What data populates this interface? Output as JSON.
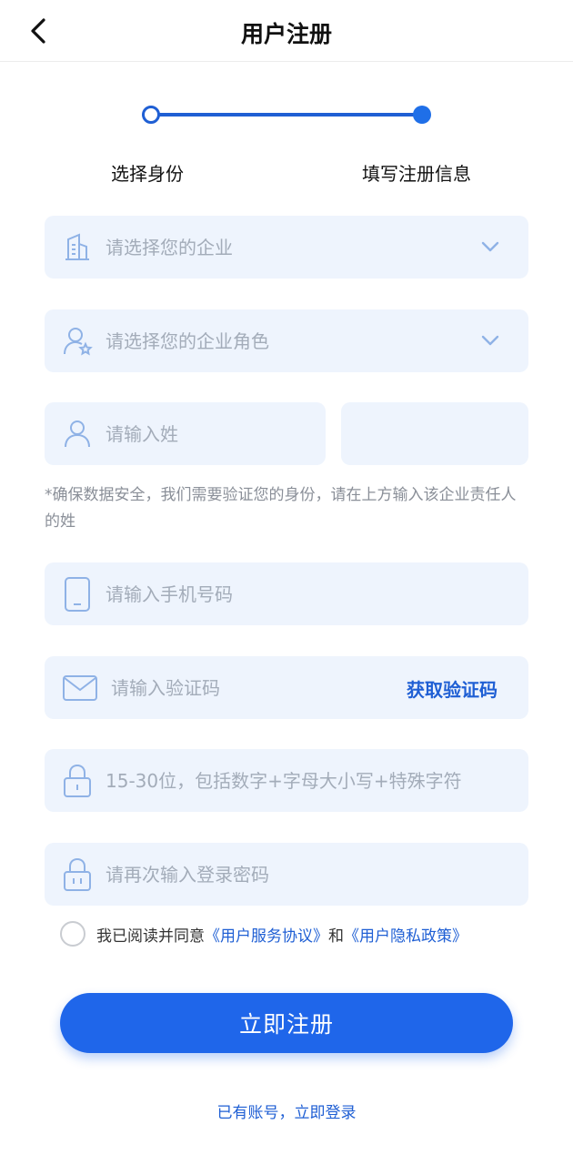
{
  "header": {
    "title": "用户注册",
    "back_icon": "chevron-left-icon"
  },
  "stepper": {
    "steps": [
      {
        "label": "选择身份",
        "state": "inactive"
      },
      {
        "label": "填写注册信息",
        "state": "active"
      }
    ],
    "color": "#1f5fd4"
  },
  "form": {
    "enterprise": {
      "placeholder": "请选择您的企业",
      "icon": "building-icon"
    },
    "role": {
      "placeholder": "请选择您的企业角色",
      "icon": "user-star-icon"
    },
    "surname": {
      "placeholder": "请输入姓",
      "icon": "user-icon"
    },
    "given_name": {
      "value": ""
    },
    "note": "*确保数据安全，我们需要验证您的身份，请在上方输入该企业责任人的姓",
    "phone": {
      "placeholder": "请输入手机号码",
      "icon": "phone-icon"
    },
    "code": {
      "placeholder": "请输入验证码",
      "icon": "mail-icon",
      "action": "获取验证码"
    },
    "password": {
      "placeholder": "15-30位，包括数字+字母大小写+特殊字符",
      "icon": "lock-icon"
    },
    "password_confirm": {
      "placeholder": "请再次输入登录密码",
      "icon": "lock-icon"
    }
  },
  "agreement": {
    "prefix": "我已阅读并同意",
    "service_link": "《用户服务协议》",
    "joiner": "和",
    "privacy_link": "《用户隐私政策》",
    "checked": false
  },
  "submit_label": "立即注册",
  "login_link": "已有账号，立即登录",
  "colors": {
    "accent": "#1f66ea",
    "field_bg": "#eef4fd",
    "placeholder": "#a3acb9"
  }
}
